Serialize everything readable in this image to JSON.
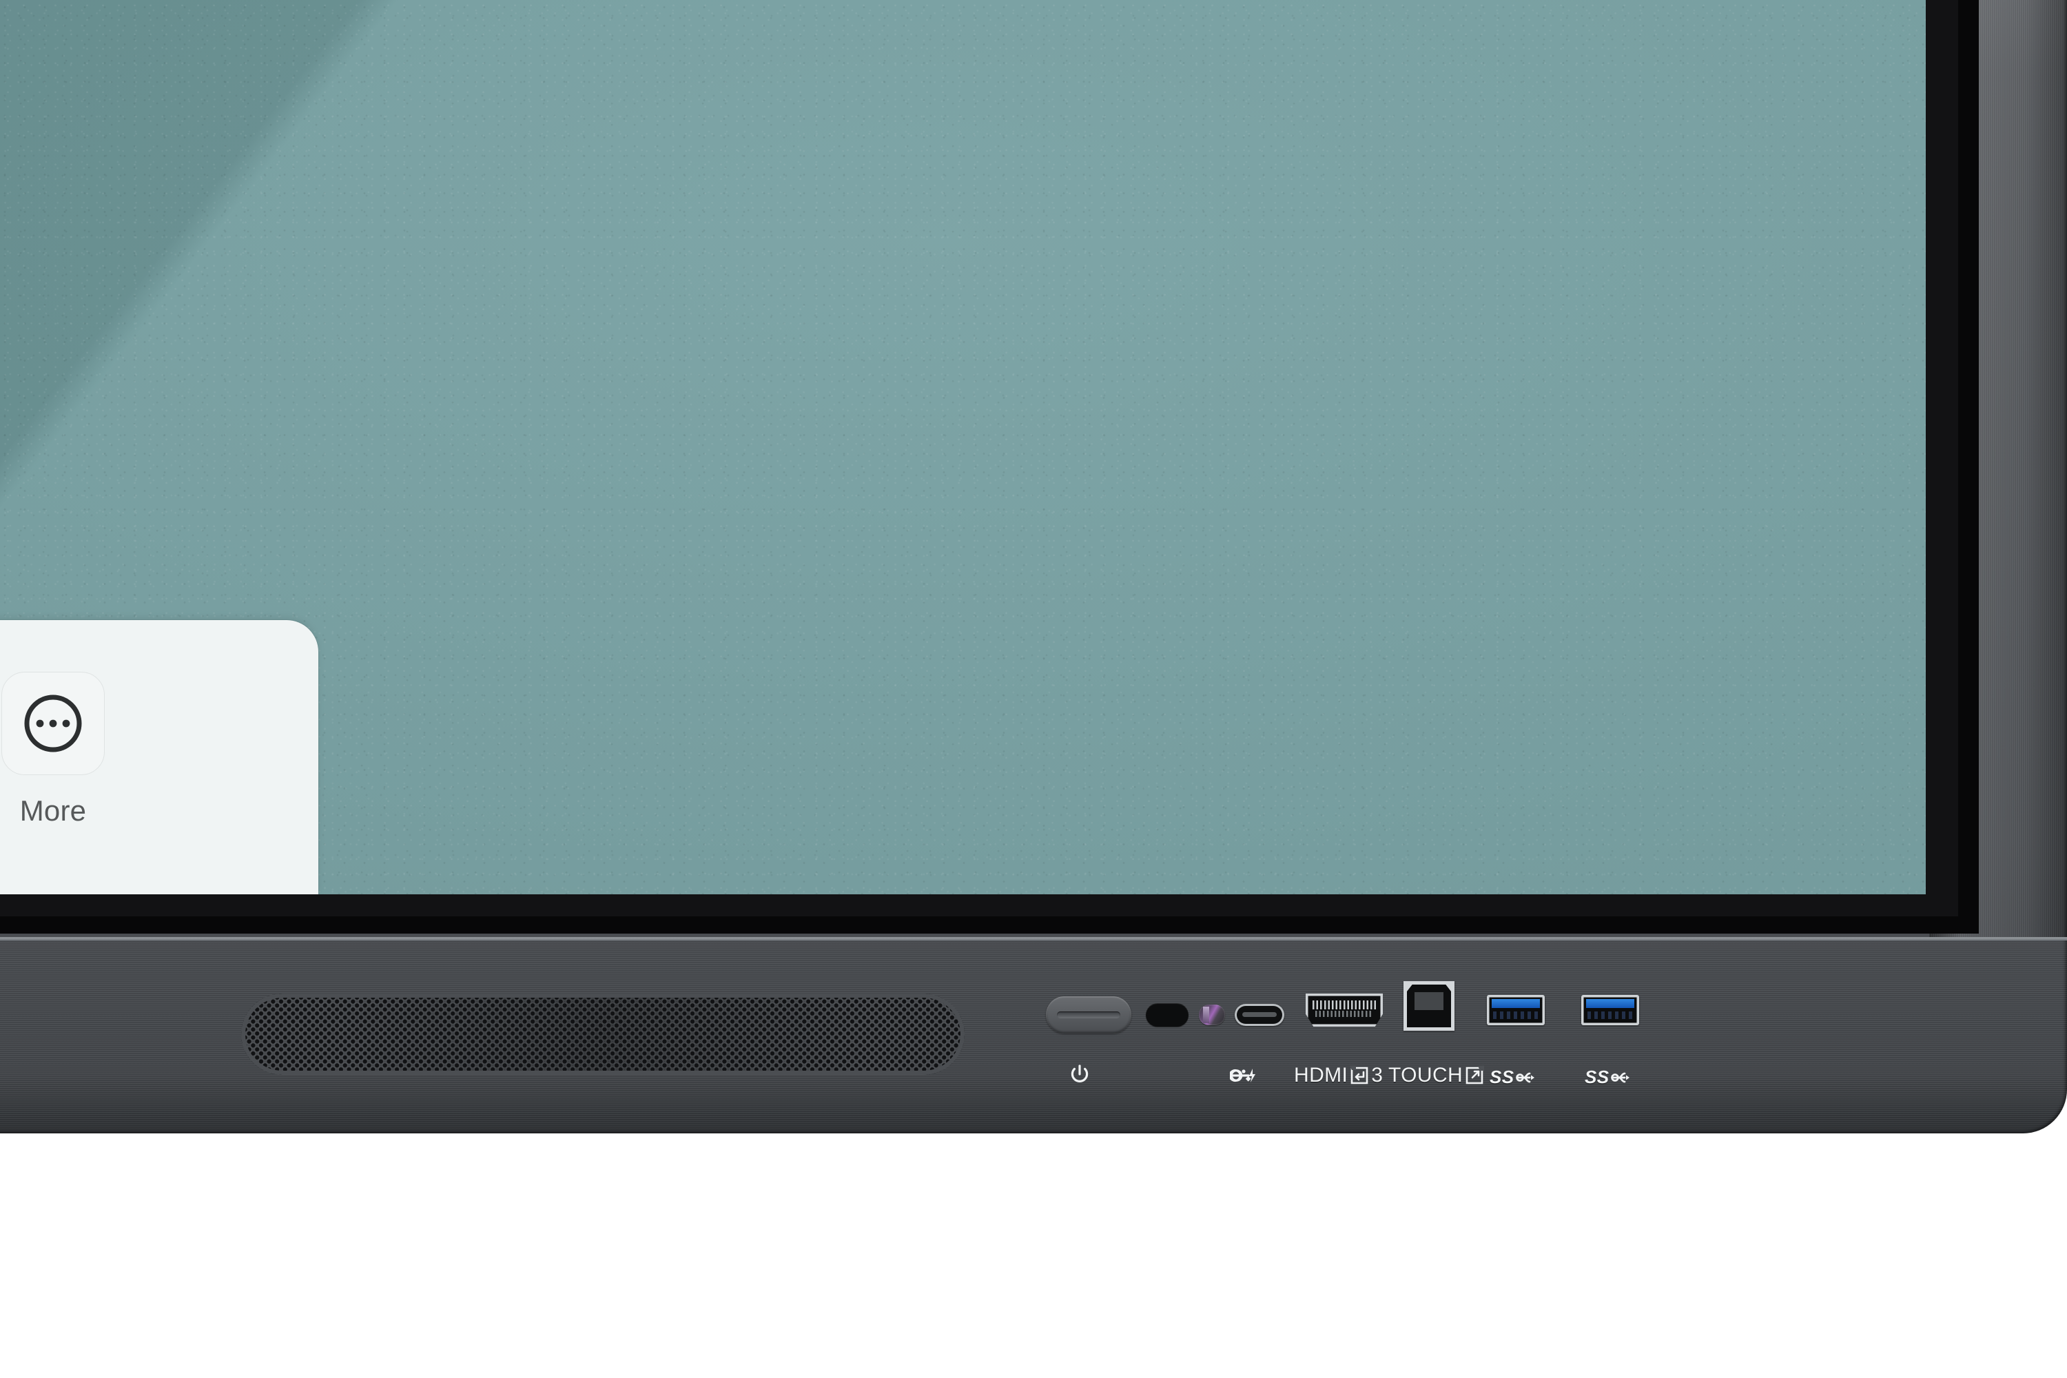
{
  "device": {
    "type": "interactive-display-panel",
    "frame_color": "#55585c",
    "bezel_color": "#121214"
  },
  "screen": {
    "background_color": "#6f9b9d",
    "description": "blank teal wallpaper"
  },
  "toolbar": {
    "background_color": "#f0f4f4",
    "items": [
      {
        "id": "partial",
        "icon": "rounded-square-icon",
        "label": ""
      },
      {
        "id": "more",
        "icon": "more-dots-circle-icon",
        "label": "More"
      }
    ]
  },
  "chin": {
    "speaker": {
      "name": "speaker-grille"
    },
    "ports": [
      {
        "id": "power",
        "icon": "power-icon",
        "label": ""
      },
      {
        "id": "ir",
        "icon": "ir-receiver-icon",
        "label": ""
      },
      {
        "id": "sensor",
        "icon": "light-sensor-icon",
        "label": ""
      },
      {
        "id": "usbc",
        "icon": "usb-c-power-icon",
        "label": ""
      },
      {
        "id": "hdmi",
        "icon": "hdmi-in-icon",
        "label": "HDMI",
        "suffix": "3"
      },
      {
        "id": "touch",
        "icon": "touch-out-icon",
        "label": "TOUCH"
      },
      {
        "id": "usb1",
        "icon": "usb-ss-icon",
        "label": "SS"
      },
      {
        "id": "usb2",
        "icon": "usb-ss-icon",
        "label": "SS"
      }
    ]
  }
}
